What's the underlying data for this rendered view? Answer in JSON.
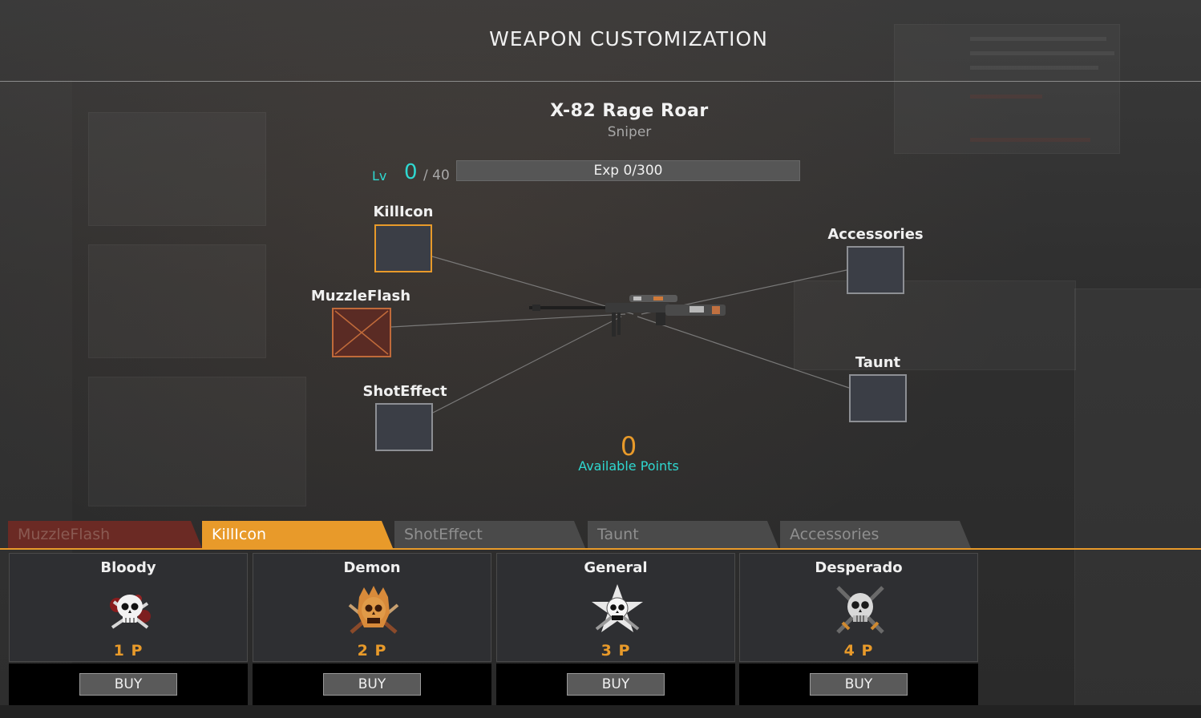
{
  "header": {
    "title": "WEAPON CUSTOMIZATION"
  },
  "weapon": {
    "name": "X-82 Rage Roar",
    "class": "Sniper"
  },
  "level": {
    "label": "Lv",
    "value": "0",
    "max": "/ 40",
    "exp_text": "Exp 0/300",
    "exp_progress": 0
  },
  "slots": {
    "killicon": "KillIcon",
    "muzzleflash": "MuzzleFlash",
    "shoteffect": "ShotEffect",
    "accessories": "Accessories",
    "taunt": "Taunt"
  },
  "points": {
    "value": "0",
    "label": "Available Points"
  },
  "tabs": [
    {
      "label": "MuzzleFlash"
    },
    {
      "label": "KillIcon"
    },
    {
      "label": "ShotEffect"
    },
    {
      "label": "Taunt"
    },
    {
      "label": "Accessories"
    }
  ],
  "selected_tab": "KillIcon",
  "cards": [
    {
      "name": "Bloody",
      "cost": "1 P",
      "buy": "BUY",
      "icon": "bloody-skull-icon"
    },
    {
      "name": "Demon",
      "cost": "2 P",
      "buy": "BUY",
      "icon": "demon-skull-icon"
    },
    {
      "name": "General",
      "cost": "3 P",
      "buy": "BUY",
      "icon": "general-skull-icon"
    },
    {
      "name": "Desperado",
      "cost": "4 P",
      "buy": "BUY",
      "icon": "desperado-skull-icon"
    }
  ],
  "colors": {
    "accent": "#e89a2a",
    "cyan": "#2fd8d0",
    "muzzle": "#6b2a24"
  }
}
